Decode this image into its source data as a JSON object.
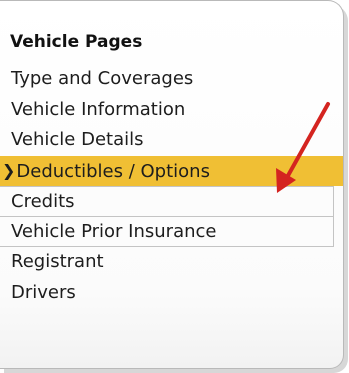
{
  "panel": {
    "title": "Vehicle Pages",
    "items": [
      {
        "label": "Type and Coverages"
      },
      {
        "label": "Vehicle Information"
      },
      {
        "label": "Vehicle Details"
      },
      {
        "label": "Deductibles / Options",
        "active": true,
        "indicator": "chevron-right"
      },
      {
        "label": "Credits"
      },
      {
        "label": "Vehicle Prior Insurance"
      },
      {
        "label": "Registrant"
      },
      {
        "label": "Drivers"
      }
    ]
  },
  "colors": {
    "active_highlight": "#f0bf34",
    "annotation_arrow": "#d42420"
  }
}
